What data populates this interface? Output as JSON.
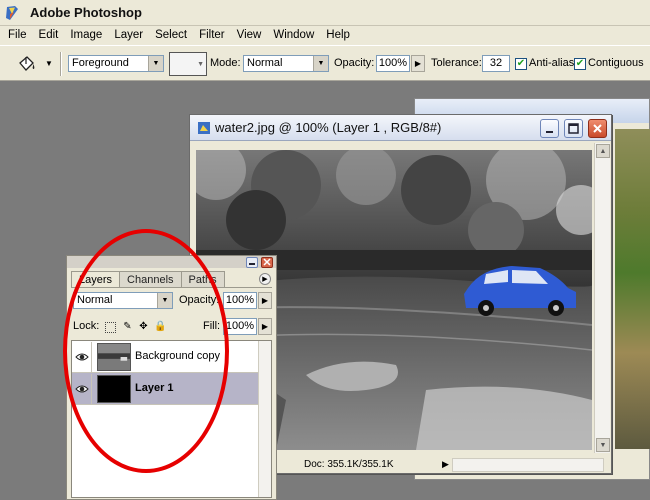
{
  "app": {
    "title": "Adobe Photoshop"
  },
  "menubar": {
    "items": [
      "File",
      "Edit",
      "Image",
      "Layer",
      "Select",
      "Filter",
      "View",
      "Window",
      "Help"
    ]
  },
  "options": {
    "fill_source": "Foreground",
    "mode_label": "Mode:",
    "mode_value": "Normal",
    "opacity_label": "Opacity:",
    "opacity_value": "100%",
    "tolerance_label": "Tolerance:",
    "tolerance_value": "32",
    "antialias_label": "Anti-alias",
    "antialias_checked": true,
    "contiguous_label": "Contiguous",
    "contiguous_checked": true
  },
  "document": {
    "title": "water2.jpg @ 100% (Layer 1 , RGB/8#)",
    "status": "Doc: 355.1K/355.1K"
  },
  "layers_panel": {
    "tabs": [
      "Layers",
      "Channels",
      "Paths"
    ],
    "active_tab": "Layers",
    "blend_mode": "Normal",
    "opacity_label": "Opacity:",
    "opacity_value": "100%",
    "lock_label": "Lock:",
    "fill_label": "Fill:",
    "fill_value": "100%",
    "layers": [
      {
        "name": "Background copy",
        "visible": true,
        "selected": false
      },
      {
        "name": "Layer 1",
        "visible": true,
        "selected": true
      }
    ]
  },
  "colors": {
    "annotation": "#e60000",
    "car": "#2f5bd3",
    "selection": "#b6b4c8"
  }
}
